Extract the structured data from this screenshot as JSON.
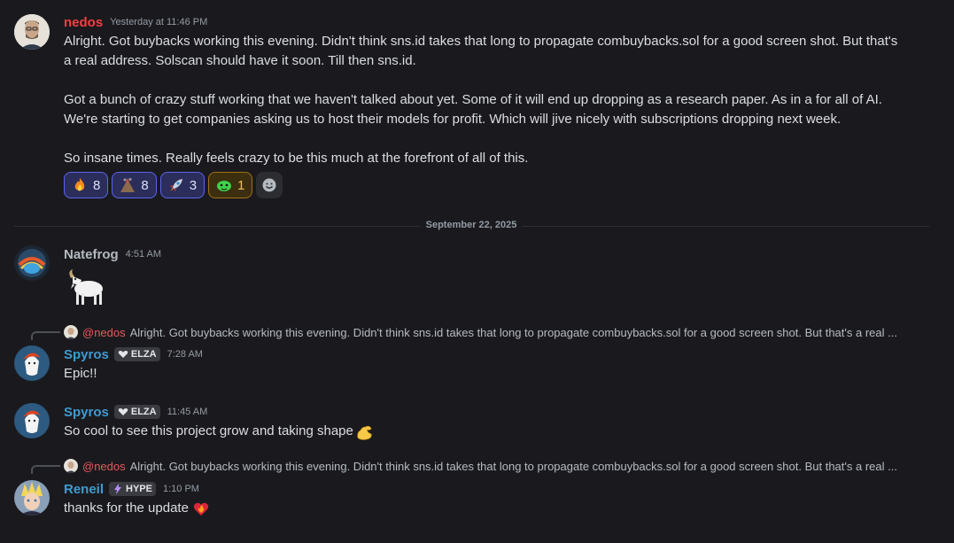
{
  "messages": {
    "m1": {
      "author": "nedos",
      "author_color": "#f23f43",
      "time": "Yesterday at 11:46 PM",
      "lines": [
        "Alright. Got buybacks working this evening. Didn't think sns.id takes that long to propagate combuybacks.sol for a good screen shot. But that's",
        "a real address. Solscan should have it soon. Till then sns.id.",
        "",
        "Got a bunch of crazy stuff working that we haven't talked about yet. Some of it will end up dropping as a research paper. As in a for all of AI.",
        "We're starting to get companies asking us to host their models for profit. Which will jive nicely with subscriptions dropping next week.",
        "",
        "So insane times. Really feels crazy to be this much at the forefront of all of this."
      ],
      "reactions": [
        {
          "emoji": "fire-emoji",
          "count": "8"
        },
        {
          "emoji": "volcano-emoji",
          "count": "8"
        },
        {
          "emoji": "rocket-emoji",
          "count": "3"
        },
        {
          "emoji": "green-blob-emoji",
          "count": "1"
        }
      ]
    },
    "divider_date": "September 22, 2025",
    "m2": {
      "author": "Natefrog",
      "author_color": "#b5bac1",
      "time": "4:51 AM",
      "emoji": "goat-emoji"
    },
    "m3": {
      "reply_mention": "@nedos",
      "reply_text": "Alright. Got buybacks working this evening. Didn't think sns.id takes that long to propagate combuybacks.sol for a good screen shot. But that's a real ...",
      "author": "Spyros",
      "author_color": "#3e9bd4",
      "badge": "ELZA",
      "time": "7:28 AM",
      "text": "Epic!!"
    },
    "m4": {
      "author": "Spyros",
      "author_color": "#3e9bd4",
      "badge": "ELZA",
      "time": "11:45 AM",
      "text": "So cool to see this project grow and taking shape"
    },
    "m5": {
      "reply_mention": "@nedos",
      "reply_text": "Alright. Got buybacks working this evening. Didn't think sns.id takes that long to propagate combuybacks.sol for a good screen shot. But that's a real ...",
      "author": "Reneil",
      "author_color": "#3e9bd4",
      "badge": "HYPE",
      "time": "1:10 PM",
      "text": "thanks for the update"
    }
  }
}
